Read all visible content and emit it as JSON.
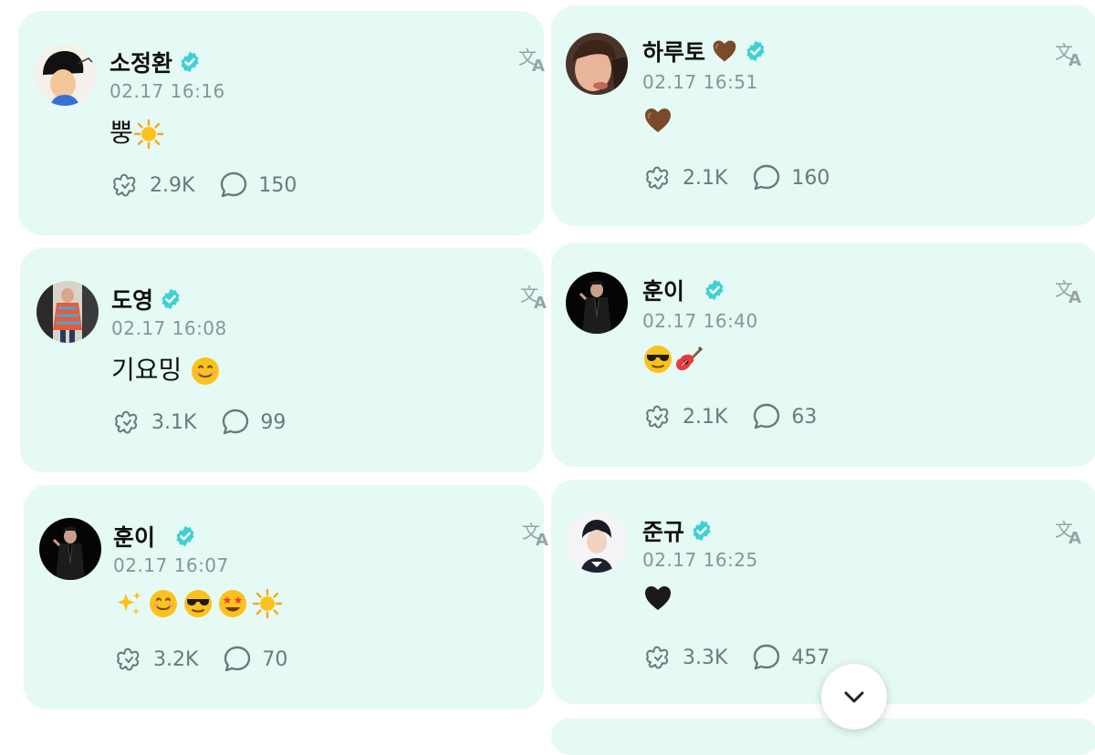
{
  "colors": {
    "card_bg": "#e5faf5",
    "badge": "#3fd0d4",
    "meta_text": "#8a9494"
  },
  "posts": [
    {
      "author": "소정환",
      "time": "02.17 16:16",
      "text": "뿡",
      "emojis": [
        "sun"
      ],
      "likes": "2.9K",
      "comments": "150",
      "verified": true
    },
    {
      "author": "하루토",
      "time": "02.17 16:51",
      "text": "",
      "emojis": [
        "brown-heart"
      ],
      "likes": "2.1K",
      "comments": "160",
      "verified": true
    },
    {
      "author": "도영",
      "time": "02.17 16:08",
      "text": "기요밍 ",
      "emojis": [
        "smile"
      ],
      "likes": "3.1K",
      "comments": "99",
      "verified": true
    },
    {
      "author": "훈이",
      "time": "02.17 16:40",
      "text": "",
      "emojis": [
        "sunglasses",
        "guitar"
      ],
      "likes": "2.1K",
      "comments": "63",
      "verified": true
    },
    {
      "author": "훈이",
      "time": "02.17 16:07",
      "text": "",
      "emojis": [
        "sparkles",
        "smile",
        "sunglasses",
        "star-struck",
        "sun"
      ],
      "likes": "3.2K",
      "comments": "70",
      "verified": true
    },
    {
      "author": "준규",
      "time": "02.17 16:25",
      "text": "",
      "emojis": [
        "black-heart"
      ],
      "likes": "3.3K",
      "comments": "457",
      "verified": true
    }
  ],
  "icons": {
    "like": "heart-hand-icon",
    "comment": "comment-bubble-icon",
    "translate": "translate-icon",
    "scroll": "chevron-down-icon"
  }
}
